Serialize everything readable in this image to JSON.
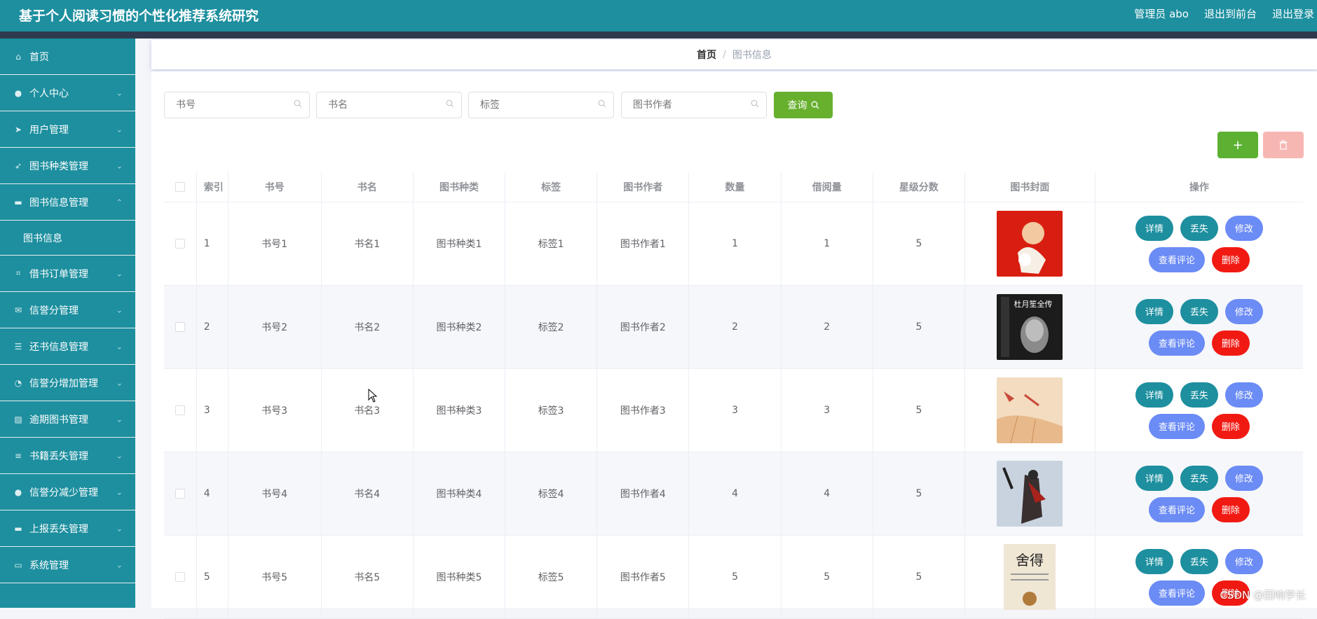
{
  "header": {
    "title": "基于个人阅读习惯的个性化推荐系统研究",
    "admin": "管理员 abo",
    "back_to_front": "退出到前台",
    "logout": "退出登录"
  },
  "sidebar": {
    "items": [
      {
        "label": "首页",
        "icon": "home-icon"
      },
      {
        "label": "个人中心",
        "icon": "user-icon"
      },
      {
        "label": "用户管理",
        "icon": "send-icon"
      },
      {
        "label": "图书种类管理",
        "icon": "navigation-icon"
      },
      {
        "label": "图书信息管理",
        "icon": "monitor-icon",
        "expanded": true
      },
      {
        "label": "借书订单管理",
        "icon": "crop-icon"
      },
      {
        "label": "信誉分管理",
        "icon": "mail-icon"
      },
      {
        "label": "还书信息管理",
        "icon": "sliders-icon"
      },
      {
        "label": "信誉分增加管理",
        "icon": "speedometer-icon"
      },
      {
        "label": "逾期图书管理",
        "icon": "picture-icon"
      },
      {
        "label": "书籍丢失管理",
        "icon": "list-icon"
      },
      {
        "label": "信誉分减少管理",
        "icon": "user-icon"
      },
      {
        "label": "上报丢失管理",
        "icon": "monitor-icon"
      },
      {
        "label": "系统管理",
        "icon": "chat-icon"
      }
    ],
    "submenu": "图书信息"
  },
  "breadcrumb": {
    "home": "首页",
    "separator": "/",
    "current": "图书信息"
  },
  "search": {
    "book_no_placeholder": "书号",
    "book_name_placeholder": "书名",
    "tag_placeholder": "标签",
    "author_placeholder": "图书作者",
    "query_label": "查询"
  },
  "toolbar": {
    "add_label": "+",
    "delete_icon": "trash-icon"
  },
  "table": {
    "headers": [
      "索引",
      "书号",
      "书名",
      "图书种类",
      "标签",
      "图书作者",
      "数量",
      "借阅量",
      "星级分数",
      "图书封面",
      "操作"
    ],
    "rows": [
      {
        "index": "1",
        "book_no": "书号1",
        "name": "书名1",
        "category": "图书种类1",
        "tag": "标签1",
        "author": "图书作者1",
        "qty": "1",
        "borrowed": "1",
        "stars": "5"
      },
      {
        "index": "2",
        "book_no": "书号2",
        "name": "书名2",
        "category": "图书种类2",
        "tag": "标签2",
        "author": "图书作者2",
        "qty": "2",
        "borrowed": "2",
        "stars": "5"
      },
      {
        "index": "3",
        "book_no": "书号3",
        "name": "书名3",
        "category": "图书种类3",
        "tag": "标签3",
        "author": "图书作者3",
        "qty": "3",
        "borrowed": "3",
        "stars": "5"
      },
      {
        "index": "4",
        "book_no": "书号4",
        "name": "书名4",
        "category": "图书种类4",
        "tag": "标签4",
        "author": "图书作者4",
        "qty": "4",
        "borrowed": "4",
        "stars": "5"
      },
      {
        "index": "5",
        "book_no": "书号5",
        "name": "书名5",
        "category": "图书种类5",
        "tag": "标签5",
        "author": "图书作者5",
        "qty": "5",
        "borrowed": "5",
        "stars": "5"
      }
    ],
    "ops": {
      "detail": "详情",
      "lost": "丢失",
      "edit": "修改",
      "view_comments": "查看评论",
      "delete": "删除"
    },
    "cover_texts": {
      "cover2": "杜月笙全传",
      "cover5": "舍得"
    }
  },
  "watermark": "CSDN @回响学长",
  "colors": {
    "primary": "#1d8f9f",
    "query": "#67b02e",
    "add": "#5cb132",
    "danger": "#f11a13",
    "blue": "#6b8bf5"
  }
}
